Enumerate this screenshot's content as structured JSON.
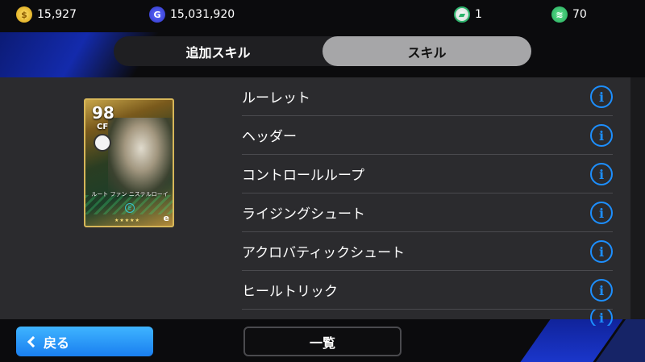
{
  "currencies": {
    "gp": {
      "icon": "gp-coin-icon",
      "symbol": "$",
      "value": "15,927"
    },
    "coins": {
      "icon": "efootball-coin-icon",
      "symbol": "G",
      "value": "15,031,920"
    },
    "tickets": {
      "icon": "ticket-icon",
      "value": "1"
    },
    "stamina": {
      "icon": "stamina-icon",
      "value": "70"
    }
  },
  "tabs": [
    {
      "label": "追加スキル",
      "active": false
    },
    {
      "label": "スキル",
      "active": true
    }
  ],
  "card": {
    "rating": "98",
    "position": "CF",
    "name": "ルート ファン ニステルローイ",
    "stars": "★★★★★",
    "badge_letter": "E",
    "brand_letter": "e"
  },
  "skills": [
    {
      "name": "ルーレット"
    },
    {
      "name": "ヘッダー"
    },
    {
      "name": "コントロールループ"
    },
    {
      "name": "ライジングシュート"
    },
    {
      "name": "アクロバティックシュート"
    },
    {
      "name": "ヒールトリック"
    }
  ],
  "info_glyph": "i",
  "bottom": {
    "back_label": "戻る",
    "list_label": "一覧"
  },
  "colors": {
    "accent_blue": "#1d8fff",
    "active_tab": "#a6a6a8",
    "panel": "#2b2b2e"
  }
}
